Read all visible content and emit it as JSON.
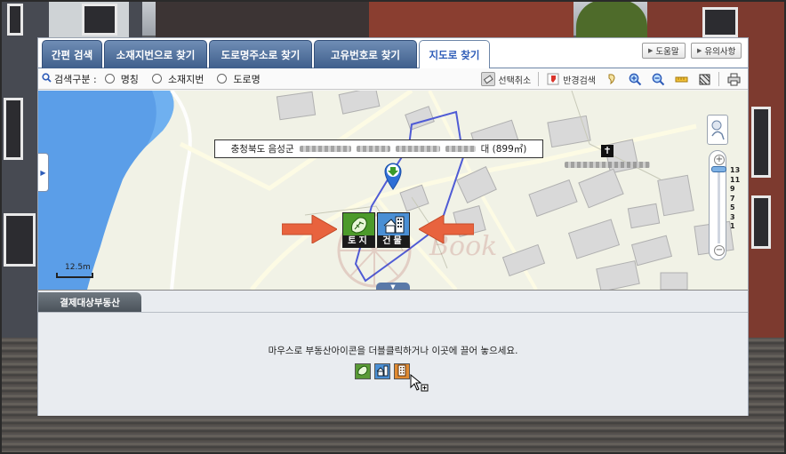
{
  "tabs": [
    {
      "label": "간편 검색",
      "active": false
    },
    {
      "label": "소재지번으로 찾기",
      "active": false
    },
    {
      "label": "도로명주소로 찾기",
      "active": false
    },
    {
      "label": "고유번호로 찾기",
      "active": false
    },
    {
      "label": "지도로 찾기",
      "active": true
    }
  ],
  "top_buttons": {
    "help": "도움말",
    "notice": "유의사항"
  },
  "search_kind": {
    "label": "검색구분 :",
    "options": [
      "명칭",
      "소재지번",
      "도로명"
    ]
  },
  "toolbar": {
    "cancel_selection": "선택취소",
    "radius_search": "반경검색"
  },
  "map": {
    "address_prefix": "충청북도 음성군",
    "address_suffix": "대 (899㎡)",
    "church_symbol": "✝",
    "land_label": "토지",
    "building_label": "건물",
    "scale_label": "12.5m",
    "zoom_levels": [
      "13",
      "11",
      "9",
      "7",
      "5",
      "3",
      "1"
    ],
    "zoom_level": 13
  },
  "panel": {
    "tab": "결제대상부동산",
    "instruction": "마우스로 부동산아이콘을 더블클릭하거나 이곳에 끌어 놓으세요."
  },
  "colors": {
    "tab_blue": "#4a6a97",
    "water": "#5b9ee8",
    "parcel_outline": "#4f5bd5",
    "pointer_arrow": "#e8633e",
    "land_green": "#4c9a2a",
    "building_blue": "#4a8fd4"
  },
  "icons": [
    "search-icon",
    "eraser-icon",
    "radius-search-icon",
    "pin-icon",
    "zoom-in-icon",
    "zoom-out-icon",
    "ruler-icon",
    "area-icon",
    "print-icon",
    "map-marker-icon",
    "land-icon",
    "building-icon",
    "apartment-icon",
    "cursor-icon",
    "church-icon"
  ]
}
